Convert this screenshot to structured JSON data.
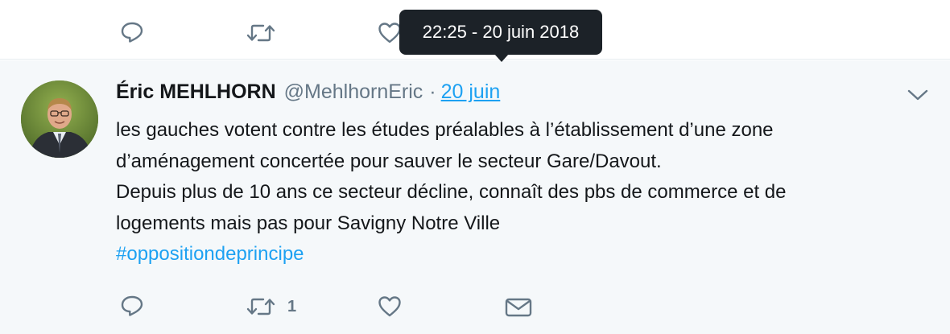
{
  "previous_tweet": {
    "actions": [
      {
        "name": "reply",
        "icon": "reply-icon"
      },
      {
        "name": "retweet",
        "icon": "retweet-icon"
      },
      {
        "name": "like",
        "icon": "heart-icon"
      }
    ]
  },
  "tooltip": {
    "text": "22:25 - 20 juin 2018"
  },
  "tweet": {
    "author": {
      "full_name": "Éric MEHLHORN",
      "handle": "@MehlhornEric"
    },
    "separator": "·",
    "date": "20 juin",
    "text_lines": [
      "les gauches votent contre les études préalables à l’établissement d’une zone",
      "d’aménagement concertée pour sauver le secteur Gare/Davout.",
      "Depuis plus de 10 ans ce secteur décline, connaît des pbs de commerce et de",
      "logements mais pas pour Savigny Notre Ville"
    ],
    "hashtag": "#oppositiondeprincipe",
    "actions": {
      "retweet_count": "1"
    }
  },
  "colors": {
    "accent": "#1da1f2",
    "muted": "#657786",
    "highlight_bg": "#f5f8fa",
    "tooltip_bg": "#1c2228"
  }
}
